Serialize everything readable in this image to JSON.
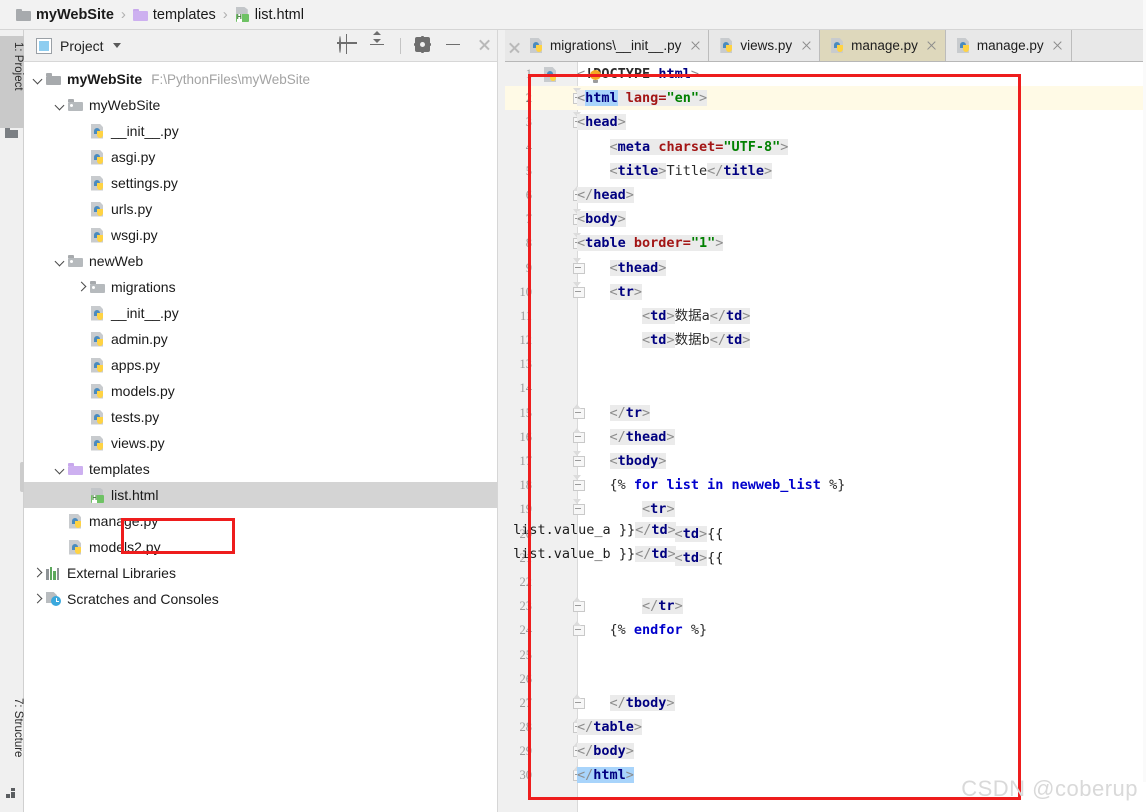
{
  "breadcrumb": {
    "items": [
      {
        "label": "myWebSite",
        "icon": "folder-icon",
        "bold": true
      },
      {
        "label": "templates",
        "icon": "folder-purple-icon",
        "bold": false
      },
      {
        "label": "list.html",
        "icon": "html5-file-icon",
        "bold": false
      }
    ],
    "separator": "›"
  },
  "left_strip": {
    "project_tab": "1: Project",
    "structure_tab": "7: Structure"
  },
  "project_panel": {
    "title": "Project",
    "tools": [
      {
        "name": "locate-in-tree-icon",
        "title": "Select Opened File"
      },
      {
        "name": "collapse-all-icon",
        "title": "Collapse All"
      },
      {
        "name": "gear-icon",
        "title": "Settings"
      },
      {
        "name": "minimize-icon",
        "title": "Hide"
      },
      {
        "name": "close-icon",
        "title": "Close"
      }
    ],
    "tree": [
      {
        "indent": 0,
        "arrow": "down",
        "icon": "folder-icon",
        "label": "myWebSite",
        "bold": true,
        "path": "F:\\PythonFiles\\myWebSite"
      },
      {
        "indent": 1,
        "arrow": "down",
        "icon": "folder-open-icon",
        "label": "myWebSite",
        "bold": false,
        "path": ""
      },
      {
        "indent": 2,
        "arrow": "none",
        "icon": "python-file-icon",
        "label": "__init__.py",
        "bold": false,
        "path": ""
      },
      {
        "indent": 2,
        "arrow": "none",
        "icon": "python-file-icon",
        "label": "asgi.py",
        "bold": false,
        "path": ""
      },
      {
        "indent": 2,
        "arrow": "none",
        "icon": "python-file-icon",
        "label": "settings.py",
        "bold": false,
        "path": ""
      },
      {
        "indent": 2,
        "arrow": "none",
        "icon": "python-file-icon",
        "label": "urls.py",
        "bold": false,
        "path": ""
      },
      {
        "indent": 2,
        "arrow": "none",
        "icon": "python-file-icon",
        "label": "wsgi.py",
        "bold": false,
        "path": ""
      },
      {
        "indent": 1,
        "arrow": "down",
        "icon": "folder-open-icon",
        "label": "newWeb",
        "bold": false,
        "path": ""
      },
      {
        "indent": 2,
        "arrow": "right",
        "icon": "folder-open-icon",
        "label": "migrations",
        "bold": false,
        "path": ""
      },
      {
        "indent": 2,
        "arrow": "none",
        "icon": "python-file-icon",
        "label": "__init__.py",
        "bold": false,
        "path": ""
      },
      {
        "indent": 2,
        "arrow": "none",
        "icon": "python-file-icon",
        "label": "admin.py",
        "bold": false,
        "path": ""
      },
      {
        "indent": 2,
        "arrow": "none",
        "icon": "python-file-icon",
        "label": "apps.py",
        "bold": false,
        "path": ""
      },
      {
        "indent": 2,
        "arrow": "none",
        "icon": "python-file-icon",
        "label": "models.py",
        "bold": false,
        "path": ""
      },
      {
        "indent": 2,
        "arrow": "none",
        "icon": "python-file-icon",
        "label": "tests.py",
        "bold": false,
        "path": ""
      },
      {
        "indent": 2,
        "arrow": "none",
        "icon": "python-file-icon",
        "label": "views.py",
        "bold": false,
        "path": ""
      },
      {
        "indent": 1,
        "arrow": "down",
        "icon": "folder-purple-icon",
        "label": "templates",
        "bold": false,
        "path": ""
      },
      {
        "indent": 2,
        "arrow": "none",
        "icon": "html5-file-icon",
        "label": "list.html",
        "bold": false,
        "path": "",
        "selected": true,
        "highlighted": true
      },
      {
        "indent": 1,
        "arrow": "none",
        "icon": "python-file-icon",
        "label": "manage.py",
        "bold": false,
        "path": ""
      },
      {
        "indent": 1,
        "arrow": "none",
        "icon": "python-file-icon",
        "label": "models2.py",
        "bold": false,
        "path": ""
      },
      {
        "indent": 0,
        "arrow": "right",
        "icon": "external-libraries-icon",
        "label": "External Libraries",
        "bold": false,
        "path": ""
      },
      {
        "indent": 0,
        "arrow": "right",
        "icon": "scratches-icon",
        "label": "Scratches and Consoles",
        "bold": false,
        "path": ""
      }
    ]
  },
  "editor": {
    "tabs": [
      {
        "label": "migrations\\__init__.py",
        "icon": "python-file-icon",
        "active": false
      },
      {
        "label": "views.py",
        "icon": "python-file-icon",
        "active": false
      },
      {
        "label": "manage.py",
        "icon": "python-file-icon",
        "active": true
      },
      {
        "label": "manage.py",
        "icon": "python-file-icon",
        "active": false
      }
    ],
    "current_line": 2,
    "lines": [
      {
        "n": 1,
        "fold": "none",
        "text": "<!DOCTYPE html>"
      },
      {
        "n": 2,
        "fold": "down",
        "text": "<html lang=\"en\">"
      },
      {
        "n": 3,
        "fold": "down",
        "text": "<head>"
      },
      {
        "n": 4,
        "fold": "none",
        "text": "    <meta charset=\"UTF-8\">"
      },
      {
        "n": 5,
        "fold": "none",
        "text": "    <title>Title</title>"
      },
      {
        "n": 6,
        "fold": "up",
        "text": "</head>"
      },
      {
        "n": 7,
        "fold": "down",
        "text": "<body>"
      },
      {
        "n": 8,
        "fold": "down",
        "text": "<table border=\"1\">"
      },
      {
        "n": 9,
        "fold": "down",
        "text": "    <thead>"
      },
      {
        "n": 10,
        "fold": "down",
        "text": "    <tr>"
      },
      {
        "n": 11,
        "fold": "none",
        "text": "        <td>数据a</td>"
      },
      {
        "n": 12,
        "fold": "none",
        "text": "        <td>数据b</td>"
      },
      {
        "n": 13,
        "fold": "none",
        "text": ""
      },
      {
        "n": 14,
        "fold": "none",
        "text": ""
      },
      {
        "n": 15,
        "fold": "up",
        "text": "    </tr>"
      },
      {
        "n": 16,
        "fold": "up",
        "text": "    </thead>"
      },
      {
        "n": 17,
        "fold": "down",
        "text": "    <tbody>"
      },
      {
        "n": 18,
        "fold": "down",
        "text": "    {% for list in newweb_list %}"
      },
      {
        "n": 19,
        "fold": "down",
        "text": "        <tr>"
      },
      {
        "n": 20,
        "fold": "none",
        "text": "            <td>{{ list.value_a }}</td>"
      },
      {
        "n": 21,
        "fold": "none",
        "text": "            <td>{{ list.value_b }}</td>"
      },
      {
        "n": 22,
        "fold": "none",
        "text": ""
      },
      {
        "n": 23,
        "fold": "up",
        "text": "        </tr>"
      },
      {
        "n": 24,
        "fold": "up",
        "text": "    {% endfor %}"
      },
      {
        "n": 25,
        "fold": "none",
        "text": ""
      },
      {
        "n": 26,
        "fold": "none",
        "text": ""
      },
      {
        "n": 27,
        "fold": "up",
        "text": "    </tbody>"
      },
      {
        "n": 28,
        "fold": "up",
        "text": "</table>"
      },
      {
        "n": 29,
        "fold": "up",
        "text": "</body>"
      },
      {
        "n": 30,
        "fold": "up",
        "text": "</html>"
      }
    ]
  },
  "annotations": {
    "red_box_tree": "list.html",
    "red_box_code": "full html source"
  },
  "watermark": "CSDN @coberup",
  "colors": {
    "annotation_red": "#ee1d1d",
    "active_tab_bg": "#ded8bc",
    "current_line_bg": "#fffae6",
    "selection_blue": "#a8d4fb",
    "tag_navy": "#000080",
    "attr_red": "#a31515",
    "value_green": "#008000",
    "django_blue": "#0000cc"
  }
}
